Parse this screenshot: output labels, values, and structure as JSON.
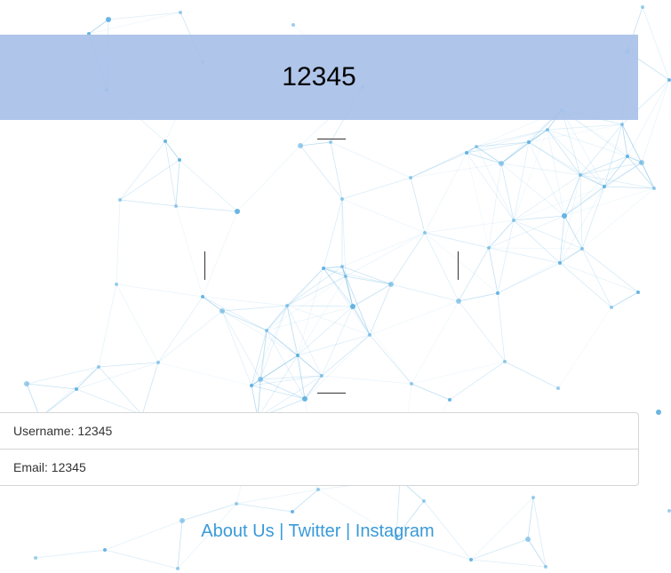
{
  "header": {
    "title": "12345"
  },
  "profile": {
    "username_label": "Username:",
    "username_value": "12345",
    "email_label": "Email:",
    "email_value": "12345"
  },
  "footer": {
    "links": [
      {
        "label": "About Us"
      },
      {
        "label": "Twitter"
      },
      {
        "label": "Instagram"
      }
    ],
    "separator": "|"
  },
  "theme": {
    "banner_color": "#a8c0e8",
    "link_color": "#3a9ad9",
    "network_color": "#5aaee0"
  }
}
